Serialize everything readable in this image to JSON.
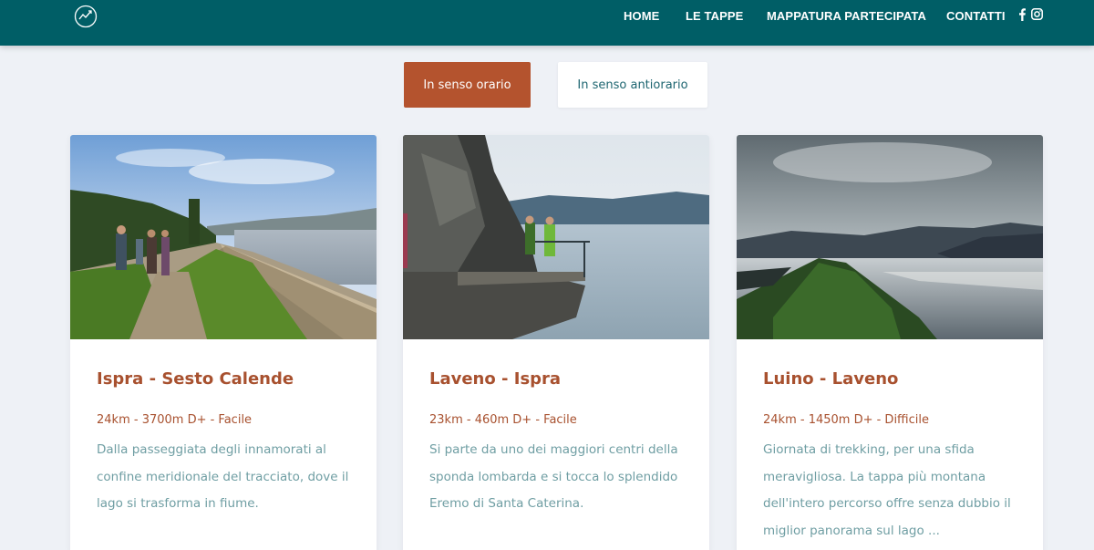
{
  "header": {
    "nav": [
      {
        "label": "HOME"
      },
      {
        "label": "LE TAPPE"
      },
      {
        "label": "MAPPATURA PARTECIPATA"
      },
      {
        "label": "CONTATTI"
      }
    ],
    "logo_icon": "mountain-logo-icon",
    "social_icons": [
      "facebook-icon",
      "instagram-icon"
    ]
  },
  "direction_toggle": {
    "clockwise_label": "In senso orario",
    "counterclockwise_label": "In senso antiorario"
  },
  "cards": [
    {
      "title": "Ispra - Sesto Calende",
      "meta": "24km - 3700m D+ - Facile",
      "description": "Dalla passeggiata degli innamorati al confine meridionale del tracciato, dove il lago si trasforma in fiume."
    },
    {
      "title": "Laveno - Ispra",
      "meta": "23km - 460m D+ - Facile",
      "description": "Si parte da uno dei maggiori centri della sponda lombarda e si tocca lo splendido Eremo di Santa Caterina."
    },
    {
      "title": "Luino - Laveno",
      "meta": "24km - 1450m D+ - Difficile",
      "description": "Giornata di trekking, per una sfida meravigliosa. La tappa più montana dell'intero percorso offre senza dubbio il miglior panorama sul lago ..."
    }
  ],
  "colors": {
    "header_bg": "#005e66",
    "accent": "#b4532e",
    "page_bg": "#eef1f6",
    "description_text": "#6f9ea3"
  }
}
